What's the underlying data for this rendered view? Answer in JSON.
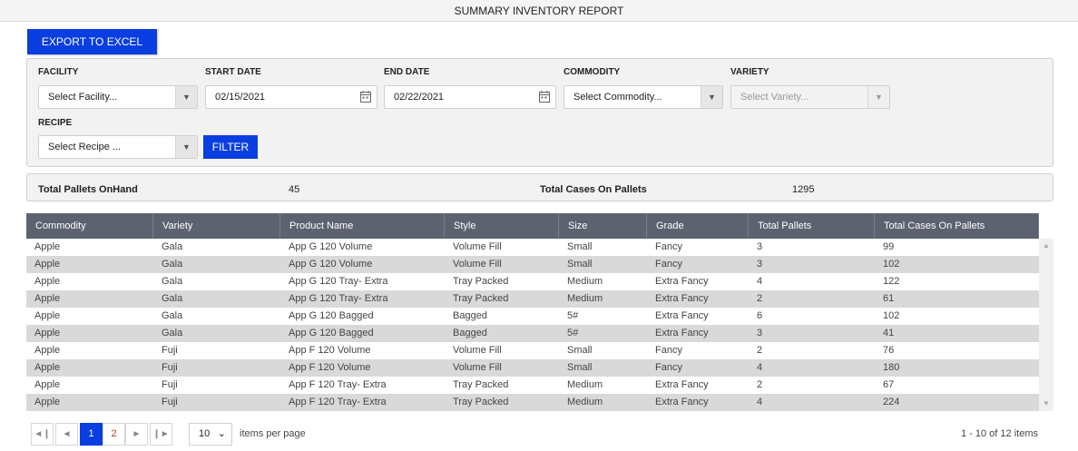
{
  "page": {
    "title": "SUMMARY INVENTORY REPORT"
  },
  "toolbar": {
    "export_label": "EXPORT TO EXCEL"
  },
  "filters": {
    "facility": {
      "label": "FACILITY",
      "value": "Select Facility..."
    },
    "start_date": {
      "label": "START DATE",
      "value": "02/15/2021"
    },
    "end_date": {
      "label": "END DATE",
      "value": "02/22/2021"
    },
    "commodity": {
      "label": "COMMODITY",
      "value": "Select Commodity..."
    },
    "variety": {
      "label": "VARIETY",
      "value": "Select Variety..."
    },
    "recipe": {
      "label": "RECIPE",
      "value": "Select Recipe ..."
    },
    "filter_label": "FILTER"
  },
  "summary": {
    "pallets_label": "Total Pallets OnHand",
    "pallets_value": "45",
    "cases_label": "Total Cases On Pallets",
    "cases_value": "1295"
  },
  "grid": {
    "columns": [
      "Commodity",
      "Variety",
      "Product Name",
      "Style",
      "Size",
      "Grade",
      "Total Pallets",
      "Total Cases On Pallets"
    ],
    "rows": [
      [
        "Apple",
        "Gala",
        "App G 120 Volume",
        "Volume Fill",
        "Small",
        "Fancy",
        "3",
        "99"
      ],
      [
        "Apple",
        "Gala",
        "App G 120 Volume",
        "Volume Fill",
        "Small",
        "Fancy",
        "3",
        "102"
      ],
      [
        "Apple",
        "Gala",
        "App G 120 Tray- Extra",
        "Tray Packed",
        "Medium",
        "Extra Fancy",
        "4",
        "122"
      ],
      [
        "Apple",
        "Gala",
        "App G 120 Tray- Extra",
        "Tray Packed",
        "Medium",
        "Extra Fancy",
        "2",
        "61"
      ],
      [
        "Apple",
        "Gala",
        "App G 120 Bagged",
        "Bagged",
        "5#",
        "Extra Fancy",
        "6",
        "102"
      ],
      [
        "Apple",
        "Gala",
        "App G 120 Bagged",
        "Bagged",
        "5#",
        "Extra Fancy",
        "3",
        "41"
      ],
      [
        "Apple",
        "Fuji",
        "App F 120 Volume",
        "Volume Fill",
        "Small",
        "Fancy",
        "2",
        "76"
      ],
      [
        "Apple",
        "Fuji",
        "App F 120 Volume",
        "Volume Fill",
        "Small",
        "Fancy",
        "4",
        "180"
      ],
      [
        "Apple",
        "Fuji",
        "App F 120 Tray- Extra",
        "Tray Packed",
        "Medium",
        "Extra Fancy",
        "2",
        "67"
      ],
      [
        "Apple",
        "Fuji",
        "App F 120 Tray- Extra",
        "Tray Packed",
        "Medium",
        "Extra Fancy",
        "4",
        "224"
      ]
    ]
  },
  "pager": {
    "first_icon": "first-page-icon",
    "prev_icon": "prev-page-icon",
    "pages": [
      "1",
      "2"
    ],
    "current_page": "1",
    "next_icon": "next-page-icon",
    "last_icon": "last-page-icon",
    "page_size": "10",
    "page_size_label": "items per page",
    "info": "1 - 10 of 12 items"
  },
  "colors": {
    "accent": "#0a3ee0",
    "header_bg": "#5d6270",
    "alt_row": "#d9d9d9",
    "page_link": "#c0392b"
  }
}
